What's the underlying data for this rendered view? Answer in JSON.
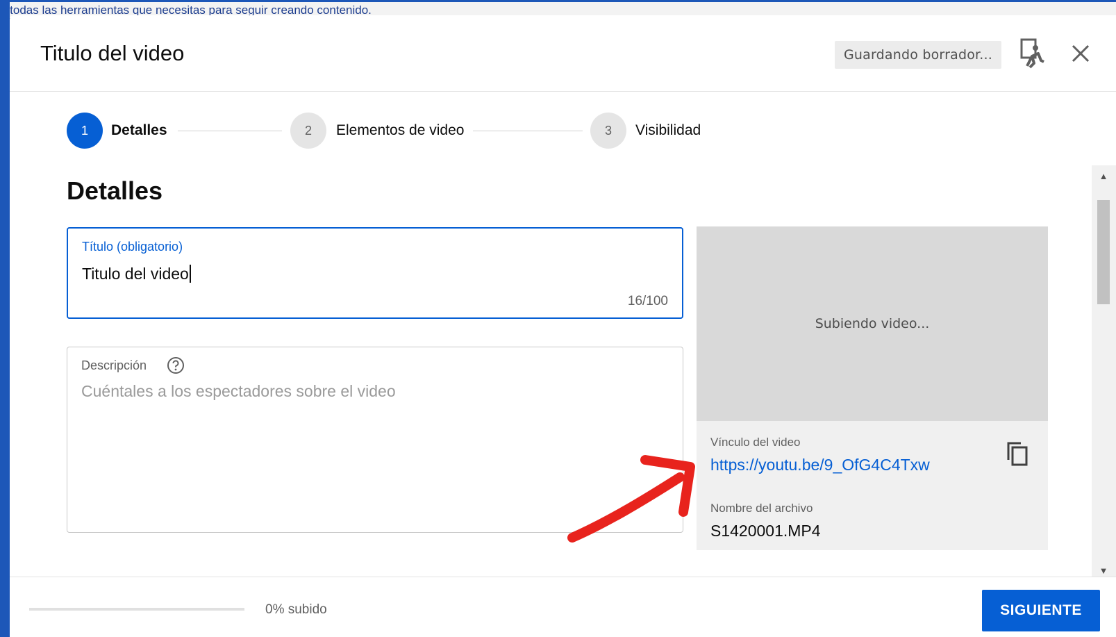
{
  "background": {
    "text": "a todas las herramientas que necesitas para seguir creando contenido."
  },
  "dialog": {
    "title": "Titulo del video",
    "saving_status": "Guardando borrador..."
  },
  "stepper": {
    "steps": [
      {
        "number": "1",
        "label": "Detalles",
        "active": true
      },
      {
        "number": "2",
        "label": "Elementos de video",
        "active": false
      },
      {
        "number": "3",
        "label": "Visibilidad",
        "active": false
      }
    ]
  },
  "details": {
    "heading": "Detalles",
    "title_field": {
      "label": "Título (obligatorio)",
      "value": "Titulo del video",
      "counter": "16/100"
    },
    "description_field": {
      "label": "Descripción",
      "placeholder": "Cuéntales a los espectadores sobre el video"
    }
  },
  "preview": {
    "status": "Subiendo video...",
    "link_label": "Vínculo del video",
    "link_value": "https://youtu.be/9_OfG4C4Txw",
    "file_label": "Nombre del archivo",
    "file_value": "S1420001.MP4"
  },
  "footer": {
    "progress_percent": 0,
    "progress_text": "0% subido",
    "next_label": "SIGUIENTE"
  },
  "colors": {
    "accent": "#065fd4",
    "annotation_arrow": "#e8231d"
  },
  "icons": {
    "feedback": "feedback-person-icon",
    "close": "close-icon",
    "help": "help-circle-icon",
    "copy": "copy-icon"
  }
}
